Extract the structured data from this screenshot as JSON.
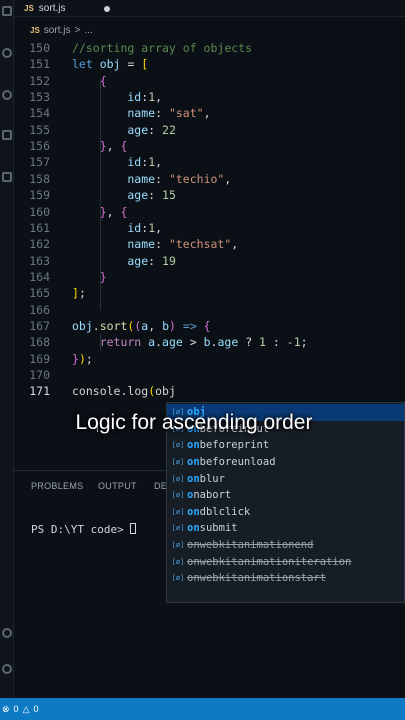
{
  "tab": {
    "badge": "JS",
    "filename": "sort.js"
  },
  "breadcrumb": {
    "badge": "JS",
    "file": "sort.js",
    "sep": ">",
    "more": "..."
  },
  "code_lines": [
    {
      "num": "150",
      "tokens": [
        {
          "t": "//sorting array of objects",
          "c": "cm"
        }
      ]
    },
    {
      "num": "151",
      "tokens": [
        {
          "t": "let ",
          "c": "kw"
        },
        {
          "t": "obj",
          "c": "var"
        },
        {
          "t": " = ",
          "c": "op"
        },
        {
          "t": "[",
          "c": "b1"
        }
      ]
    },
    {
      "num": "152",
      "tokens": [
        {
          "t": "    {",
          "c": "b2"
        }
      ]
    },
    {
      "num": "153",
      "tokens": [
        {
          "t": "        id",
          "c": "var"
        },
        {
          "t": ":",
          "c": "pl"
        },
        {
          "t": "1",
          "c": "num"
        },
        {
          "t": ",",
          "c": "pl"
        }
      ]
    },
    {
      "num": "154",
      "tokens": [
        {
          "t": "        name",
          "c": "var"
        },
        {
          "t": ": ",
          "c": "pl"
        },
        {
          "t": "\"sat\"",
          "c": "str"
        },
        {
          "t": ",",
          "c": "pl"
        }
      ]
    },
    {
      "num": "155",
      "tokens": [
        {
          "t": "        age",
          "c": "var"
        },
        {
          "t": ": ",
          "c": "pl"
        },
        {
          "t": "22",
          "c": "num"
        }
      ]
    },
    {
      "num": "156",
      "tokens": [
        {
          "t": "    }",
          "c": "b2"
        },
        {
          "t": ", ",
          "c": "pl"
        },
        {
          "t": "{",
          "c": "b2"
        }
      ]
    },
    {
      "num": "157",
      "tokens": [
        {
          "t": "        id",
          "c": "var"
        },
        {
          "t": ":",
          "c": "pl"
        },
        {
          "t": "1",
          "c": "num"
        },
        {
          "t": ",",
          "c": "pl"
        }
      ]
    },
    {
      "num": "158",
      "tokens": [
        {
          "t": "        name",
          "c": "var"
        },
        {
          "t": ": ",
          "c": "pl"
        },
        {
          "t": "\"techio\"",
          "c": "str"
        },
        {
          "t": ",",
          "c": "pl"
        }
      ]
    },
    {
      "num": "159",
      "tokens": [
        {
          "t": "        age",
          "c": "var"
        },
        {
          "t": ": ",
          "c": "pl"
        },
        {
          "t": "15",
          "c": "num"
        }
      ]
    },
    {
      "num": "160",
      "tokens": [
        {
          "t": "    }",
          "c": "b2"
        },
        {
          "t": ", ",
          "c": "pl"
        },
        {
          "t": "{",
          "c": "b2"
        }
      ]
    },
    {
      "num": "161",
      "tokens": [
        {
          "t": "        id",
          "c": "var"
        },
        {
          "t": ":",
          "c": "pl"
        },
        {
          "t": "1",
          "c": "num"
        },
        {
          "t": ",",
          "c": "pl"
        }
      ]
    },
    {
      "num": "162",
      "tokens": [
        {
          "t": "        name",
          "c": "var"
        },
        {
          "t": ": ",
          "c": "pl"
        },
        {
          "t": "\"techsat\"",
          "c": "str"
        },
        {
          "t": ",",
          "c": "pl"
        }
      ]
    },
    {
      "num": "163",
      "tokens": [
        {
          "t": "        age",
          "c": "var"
        },
        {
          "t": ": ",
          "c": "pl"
        },
        {
          "t": "19",
          "c": "num"
        }
      ]
    },
    {
      "num": "164",
      "tokens": [
        {
          "t": "    }",
          "c": "b2"
        }
      ]
    },
    {
      "num": "165",
      "tokens": [
        {
          "t": "]",
          "c": "b1"
        },
        {
          "t": ";",
          "c": "pl"
        }
      ]
    },
    {
      "num": "166",
      "tokens": []
    },
    {
      "num": "167",
      "tokens": [
        {
          "t": "obj",
          "c": "var"
        },
        {
          "t": ".",
          "c": "pl"
        },
        {
          "t": "sort",
          "c": "fn"
        },
        {
          "t": "(",
          "c": "b1"
        },
        {
          "t": "(",
          "c": "b2"
        },
        {
          "t": "a",
          "c": "var"
        },
        {
          "t": ", ",
          "c": "pl"
        },
        {
          "t": "b",
          "c": "var"
        },
        {
          "t": ")",
          "c": "b2"
        },
        {
          "t": " => ",
          "c": "kw"
        },
        {
          "t": "{",
          "c": "b2"
        }
      ]
    },
    {
      "num": "168",
      "tokens": [
        {
          "t": "    return ",
          "c": "cf"
        },
        {
          "t": "a",
          "c": "var"
        },
        {
          "t": ".",
          "c": "pl"
        },
        {
          "t": "age",
          "c": "var"
        },
        {
          "t": " > ",
          "c": "op"
        },
        {
          "t": "b",
          "c": "var"
        },
        {
          "t": ".",
          "c": "pl"
        },
        {
          "t": "age",
          "c": "var"
        },
        {
          "t": " ? ",
          "c": "op"
        },
        {
          "t": "1",
          "c": "num"
        },
        {
          "t": " : ",
          "c": "op"
        },
        {
          "t": "-1",
          "c": "num"
        },
        {
          "t": ";",
          "c": "pl"
        }
      ]
    },
    {
      "num": "169",
      "tokens": [
        {
          "t": "}",
          "c": "b2"
        },
        {
          "t": ")",
          "c": "b1"
        },
        {
          "t": ";",
          "c": "pl"
        }
      ]
    },
    {
      "num": "170",
      "tokens": []
    },
    {
      "num": "171",
      "tokens": [
        {
          "t": "console",
          "c": "pl"
        },
        {
          "t": ".",
          "c": "pl"
        },
        {
          "t": "log",
          "c": "pl"
        },
        {
          "t": "(",
          "c": "b1"
        },
        {
          "t": "obj",
          "c": "pl"
        }
      ]
    }
  ],
  "active_line": "171",
  "caption": "Logic for ascending order",
  "suggestions": [
    {
      "icon": "[ø]",
      "match": "obj",
      "rest": "",
      "selected": true,
      "deprecated": false
    },
    {
      "icon": "[ø]",
      "match": "on",
      "rest": "beforeinput",
      "selected": false,
      "deprecated": false
    },
    {
      "icon": "[ø]",
      "match": "on",
      "rest": "beforeprint",
      "selected": false,
      "deprecated": false
    },
    {
      "icon": "[ø]",
      "match": "on",
      "rest": "beforeunload",
      "selected": false,
      "deprecated": false
    },
    {
      "icon": "[ø]",
      "match": "on",
      "rest": "blur",
      "selected": false,
      "deprecated": false
    },
    {
      "icon": "[ø]",
      "match": "o",
      "rest": "nabort",
      "selected": false,
      "deprecated": false
    },
    {
      "icon": "[ø]",
      "match": "on",
      "rest": "dblclick",
      "selected": false,
      "deprecated": false
    },
    {
      "icon": "[ø]",
      "match": "on",
      "rest": "submit",
      "selected": false,
      "deprecated": false
    },
    {
      "icon": "[ø]",
      "match": "",
      "rest": "onwebkitanimationend",
      "selected": false,
      "deprecated": true
    },
    {
      "icon": "[ø]",
      "match": "",
      "rest": "onwebkitanimationiteration",
      "selected": false,
      "deprecated": true
    },
    {
      "icon": "[ø]",
      "match": "",
      "rest": "onwebkitanimationstart",
      "selected": false,
      "deprecated": true
    }
  ],
  "panel": {
    "tabs": [
      "PROBLEMS",
      "OUTPUT",
      "DE"
    ],
    "prompt": "PS D:\\YT code> "
  },
  "status": {
    "errors": "0",
    "warnings": "0"
  },
  "colors": {
    "accent": "#0e7ac4",
    "selection": "#0a3a75",
    "match": "#2aa8ff"
  },
  "icons": [
    "explorer-icon",
    "search-icon",
    "source-control-icon",
    "run-debug-icon",
    "extensions-icon",
    "account-icon",
    "settings-icon",
    "error-icon",
    "warning-icon",
    "variable-icon"
  ]
}
